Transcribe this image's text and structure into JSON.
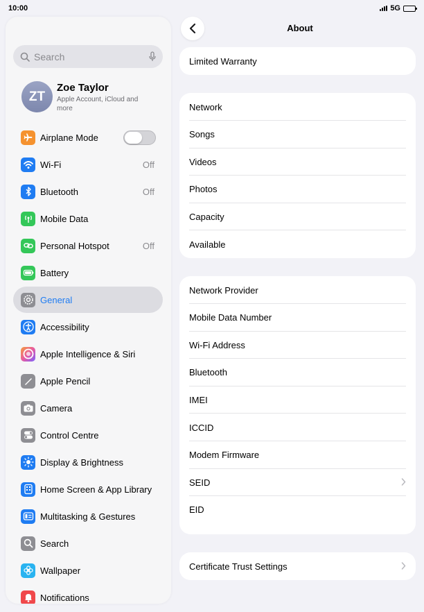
{
  "status": {
    "time": "10:00",
    "network": "5G"
  },
  "sidebar": {
    "search_placeholder": "Search",
    "profile": {
      "initials": "ZT",
      "name": "Zoe Taylor",
      "subtitle": "Apple Account, iCloud and more"
    },
    "items": [
      {
        "label": "Airplane Mode",
        "icon": "airplane-icon",
        "color": "#f5922f",
        "toggle": "off"
      },
      {
        "label": "Wi-Fi",
        "icon": "wifi-icon",
        "color": "#1f7cf2",
        "value": "Off"
      },
      {
        "label": "Bluetooth",
        "icon": "bluetooth-icon",
        "color": "#1f7cf2",
        "value": "Off"
      },
      {
        "label": "Mobile Data",
        "icon": "antenna-icon",
        "color": "#34c759"
      },
      {
        "label": "Personal Hotspot",
        "icon": "hotspot-icon",
        "color": "#34c759",
        "value": "Off"
      },
      {
        "label": "Battery",
        "icon": "battery-icon",
        "color": "#34c759"
      },
      {
        "label": "General",
        "icon": "gear-icon",
        "color": "#8e8e93",
        "selected": true
      },
      {
        "label": "Accessibility",
        "icon": "accessibility-icon",
        "color": "#1f7cf2"
      },
      {
        "label": "Apple Intelligence & Siri",
        "icon": "siri-icon",
        "color": "#e85ba0"
      },
      {
        "label": "Apple Pencil",
        "icon": "pencil-icon",
        "color": "#8e8e93"
      },
      {
        "label": "Camera",
        "icon": "camera-icon",
        "color": "#8e8e93"
      },
      {
        "label": "Control Centre",
        "icon": "toggles-icon",
        "color": "#8e8e93"
      },
      {
        "label": "Display & Brightness",
        "icon": "sun-icon",
        "color": "#1f7cf2"
      },
      {
        "label": "Home Screen & App Library",
        "icon": "home-screen-icon",
        "color": "#1f7cf2"
      },
      {
        "label": "Multitasking & Gestures",
        "icon": "multitasking-icon",
        "color": "#1f7cf2"
      },
      {
        "label": "Search",
        "icon": "search-icon",
        "color": "#8e8e93"
      },
      {
        "label": "Wallpaper",
        "icon": "flower-icon",
        "color": "#29b3f0"
      },
      {
        "label": "Notifications",
        "icon": "bell-icon",
        "color": "#f0484b"
      }
    ]
  },
  "detail": {
    "title": "About",
    "groups": [
      [
        {
          "label": "Limited Warranty"
        }
      ],
      [
        {
          "label": "Network"
        },
        {
          "label": "Songs"
        },
        {
          "label": "Videos"
        },
        {
          "label": "Photos"
        },
        {
          "label": "Capacity"
        },
        {
          "label": "Available"
        }
      ],
      [
        {
          "label": "Network Provider"
        },
        {
          "label": "Mobile Data Number"
        },
        {
          "label": "Wi-Fi Address"
        },
        {
          "label": "Bluetooth"
        },
        {
          "label": "IMEI"
        },
        {
          "label": "ICCID"
        },
        {
          "label": "Modem Firmware"
        },
        {
          "label": "SEID",
          "chevron": true
        },
        {
          "label": "EID"
        }
      ],
      [
        {
          "label": "Certificate Trust Settings",
          "chevron": true
        }
      ]
    ]
  }
}
